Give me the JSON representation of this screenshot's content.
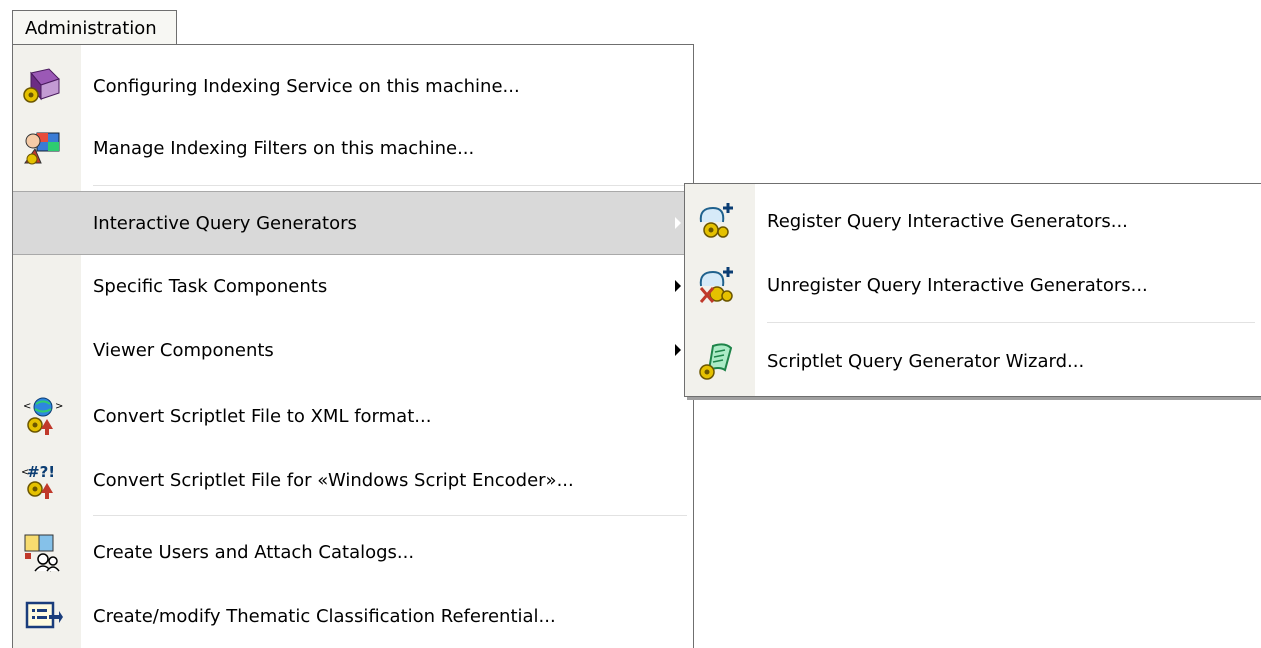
{
  "menubar": {
    "tab_label": "Administration"
  },
  "main_menu": {
    "items": [
      {
        "label": "Configuring Indexing Service on this machine...",
        "icon": "indexing-service-icon"
      },
      {
        "label": "Manage Indexing Filters on this machine...",
        "icon": "indexing-filters-icon"
      },
      {
        "label": "Interactive Query Generators",
        "submenu": true,
        "highlighted": true
      },
      {
        "label": "Specific Task Components",
        "submenu": true
      },
      {
        "label": "Viewer Components",
        "submenu": true
      },
      {
        "label": "Convert Scriptlet File to XML format...",
        "icon": "scriptlet-xml-icon"
      },
      {
        "label": "Convert Scriptlet File for «Windows Script Encoder»...",
        "icon": "script-encoder-icon"
      },
      {
        "label": "Create Users and Attach Catalogs...",
        "icon": "users-catalogs-icon"
      },
      {
        "label": "Create/modify Thematic Classification Referential...",
        "icon": "thematic-classification-icon"
      }
    ]
  },
  "submenu": {
    "items": [
      {
        "label": "Register Query Interactive Generators...",
        "icon": "register-generator-icon"
      },
      {
        "label": "Unregister Query Interactive Generators...",
        "icon": "unregister-generator-icon"
      },
      {
        "label": "Scriptlet Query Generator Wizard...",
        "icon": "scriptlet-wizard-icon"
      }
    ]
  },
  "colors": {
    "gutter": "#f2f1ec",
    "highlight": "#d9d9d9",
    "border": "#6f6f6f"
  }
}
